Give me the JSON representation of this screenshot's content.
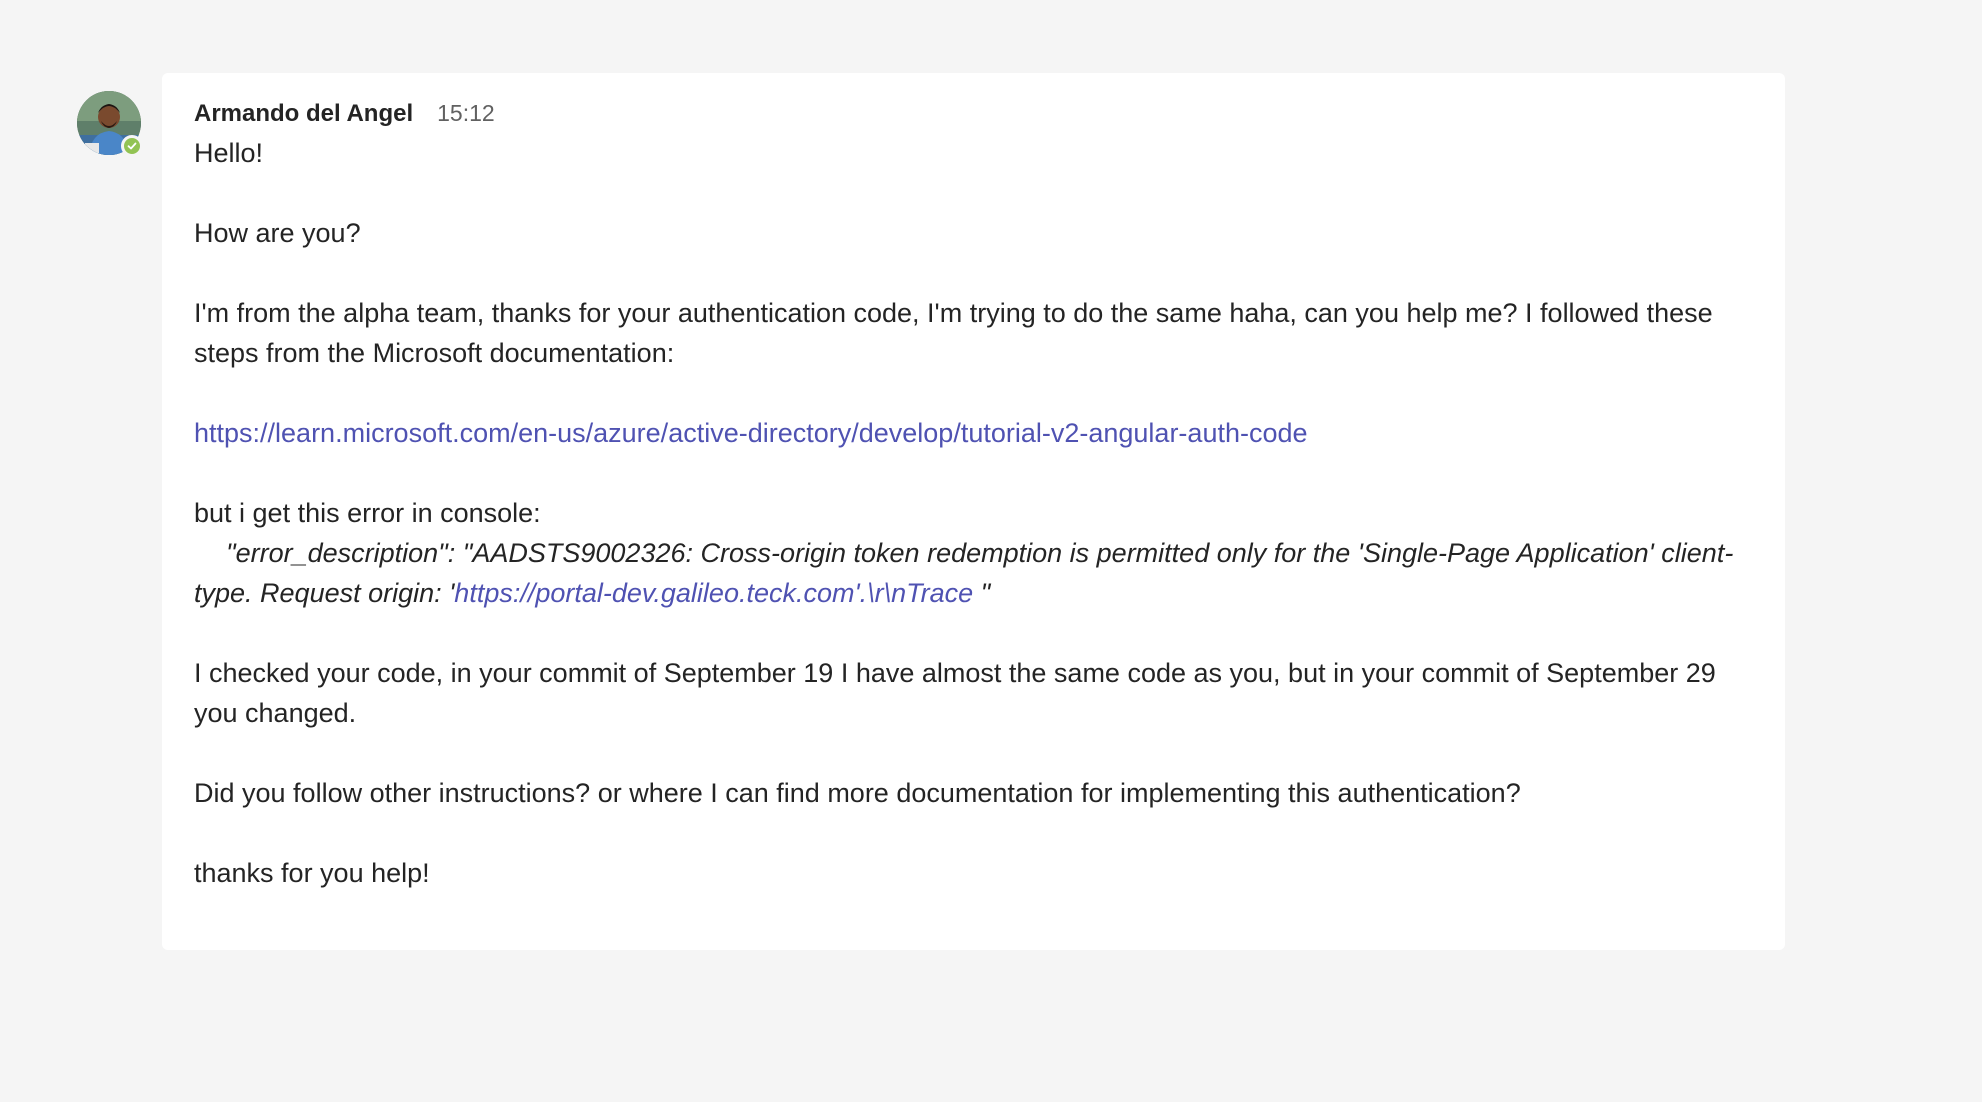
{
  "message": {
    "author": "Armando del Angel",
    "time": "15:12",
    "lines": {
      "greeting": "Hello!",
      "how_are_you": "How are you?",
      "intro": "I'm from the alpha team, thanks for your authentication code, I'm trying to do the same haha, can you help me? I followed these steps from the Microsoft documentation:",
      "doc_link": "https://learn.microsoft.com/en-us/azure/active-directory/develop/tutorial-v2-angular-auth-code",
      "error_intro": "but i get this error in console:",
      "error_prefix": "\"error_description\": \"AADSTS9002326: Cross-origin token redemption is permitted only for the 'Single-Page Application' client-type. Request origin: '",
      "error_link": "https://portal-dev.galileo.teck.com'.\\r\\nTrace",
      "error_suffix": " \"",
      "commit_note": "I checked your code, in your commit of September 19 I have almost the same code as you, but in your commit of September 29 you changed.",
      "question": "Did you follow other instructions? or where I can find more documentation for implementing this authentication?",
      "thanks": "thanks for you help!"
    }
  },
  "avatar": {
    "icon": "user-avatar",
    "status_icon": "check-icon",
    "status_color": "#92c353"
  },
  "colors": {
    "link": "#4f52b2",
    "background": "#f5f5f5",
    "card": "#ffffff"
  }
}
